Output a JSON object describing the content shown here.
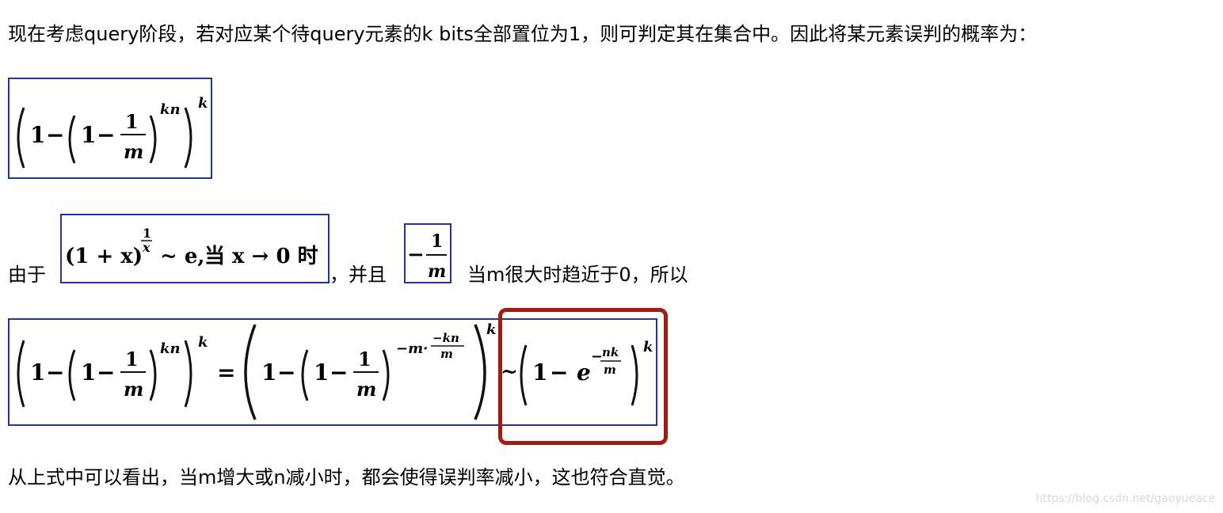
{
  "paragraphs": {
    "intro": "现在考虑query阶段，若对应某个待query元素的k bits全部置位为1，则可判定其在集合中。因此将某元素误判的概率为：",
    "youyu": "由于",
    "bingqie": "，并且",
    "dang": "当m很大时趋近于0，所以",
    "conclusion": "从上式中可以看出，当m增大或n减小时，都会使得误判率减小，这也符合直觉。"
  },
  "formulas": {
    "f2_limit_text": "当 x → 0 时",
    "f2_approx": "~ e,",
    "f3_numerator": "1",
    "f3_denominator": "m"
  },
  "watermark": "https://blog.csdn.net/gaoyueace",
  "colors": {
    "formula_border": "#1f3a80",
    "highlight": "#a11c10",
    "watermark": "#d9d9d9"
  }
}
